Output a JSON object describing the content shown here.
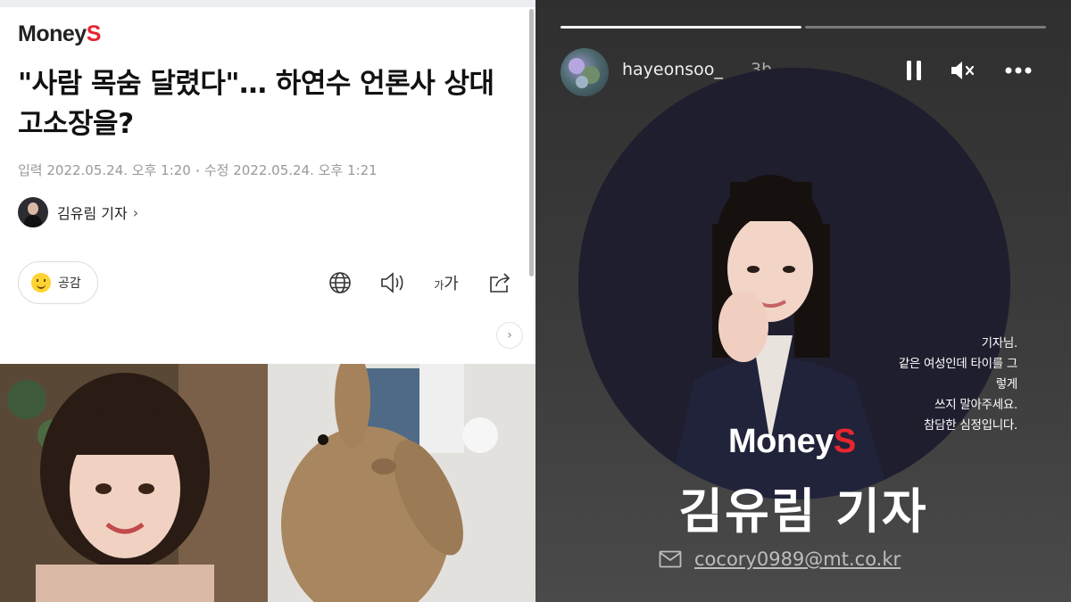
{
  "article": {
    "brand_main": "Money",
    "brand_accent": "S",
    "headline": "\"사람 목숨 달렸다\"… 하연수 언론사 상대 고소장을?",
    "published": "입력 2022.05.24. 오후 1:20",
    "modified": "수정 2022.05.24. 오후 1:21",
    "reporter_name": "김유림 기자",
    "reporter_chevron": "›",
    "empathy_label": "공감",
    "fontsize_small": "가",
    "fontsize_large": "가",
    "next_arrow": "›",
    "icons": [
      "globe-icon",
      "speaker-icon",
      "share-icon"
    ],
    "colors": {
      "brand_red": "#e6262f",
      "text": "#111111",
      "meta": "#999999"
    }
  },
  "story": {
    "username": "hayeonsoo_",
    "time": "3h",
    "progress": [
      1,
      0
    ],
    "controls": [
      "pause-icon",
      "mute-icon",
      "more-icon"
    ],
    "quote_lines": [
      "기자님.",
      "같은 여성인데 타이를 그렇게",
      "쓰지 말아주세요.",
      "참담한 심정입니다."
    ],
    "brand_main": "Money",
    "brand_accent": "S",
    "reporter_name": "김유림 기자",
    "email": "cocory0989@mt.co.kr",
    "colors": {
      "background": "#3a3a3a",
      "circle": "#1f1e2e"
    }
  }
}
